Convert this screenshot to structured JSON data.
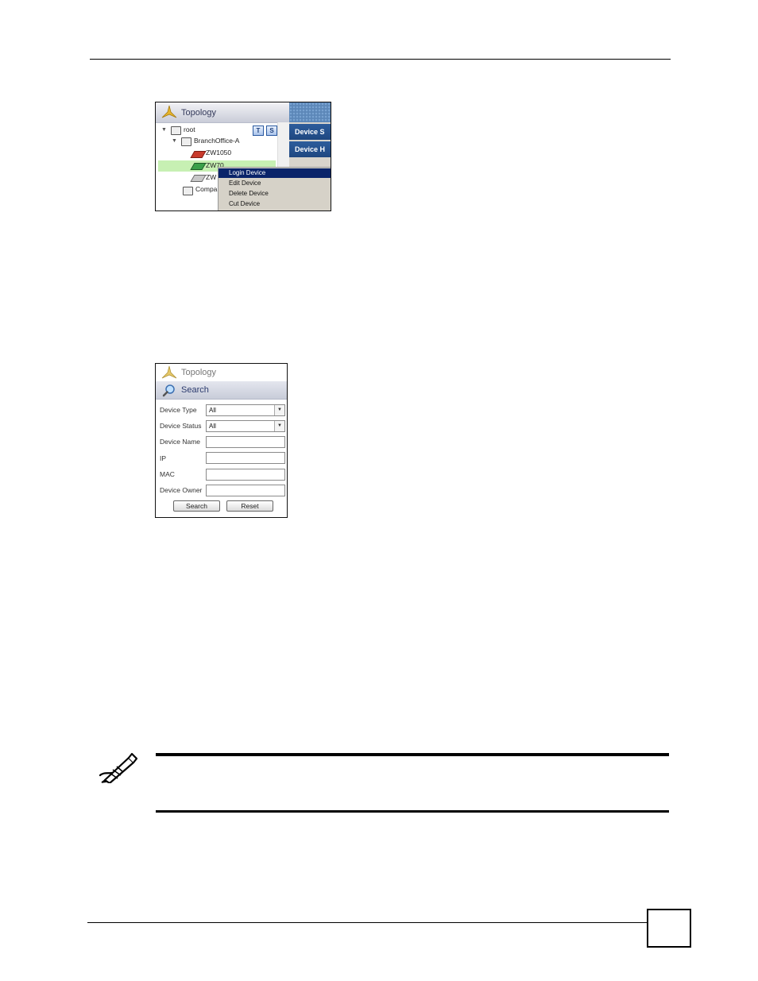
{
  "figure1": {
    "header_title": "Topology",
    "tree": {
      "root": "root",
      "branch": "BranchOffice-A",
      "device1": "ZW1050",
      "device2": "ZW70",
      "device3": "ZW",
      "company": "Compa"
    },
    "tabs": [
      "Device S",
      "Device H"
    ],
    "context_menu": [
      "Login Device",
      "Edit Device",
      "Delete Device",
      "Cut Device"
    ],
    "mini_buttons": [
      "T",
      "S"
    ]
  },
  "figure2": {
    "topology_title": "Topology",
    "search_title": "Search",
    "fields": {
      "device_type": {
        "label": "Device Type",
        "value": "All"
      },
      "device_status": {
        "label": "Device Status",
        "value": "All"
      },
      "device_name": {
        "label": "Device Name",
        "value": ""
      },
      "ip": {
        "label": "IP",
        "value": ""
      },
      "mac": {
        "label": "MAC",
        "value": ""
      },
      "device_owner": {
        "label": "Device Owner",
        "value": ""
      }
    },
    "search_button": "Search",
    "reset_button": "Reset"
  },
  "icons": {
    "topology": "topology-icon",
    "search": "magnifier-icon",
    "note": "pencil-note-icon"
  }
}
